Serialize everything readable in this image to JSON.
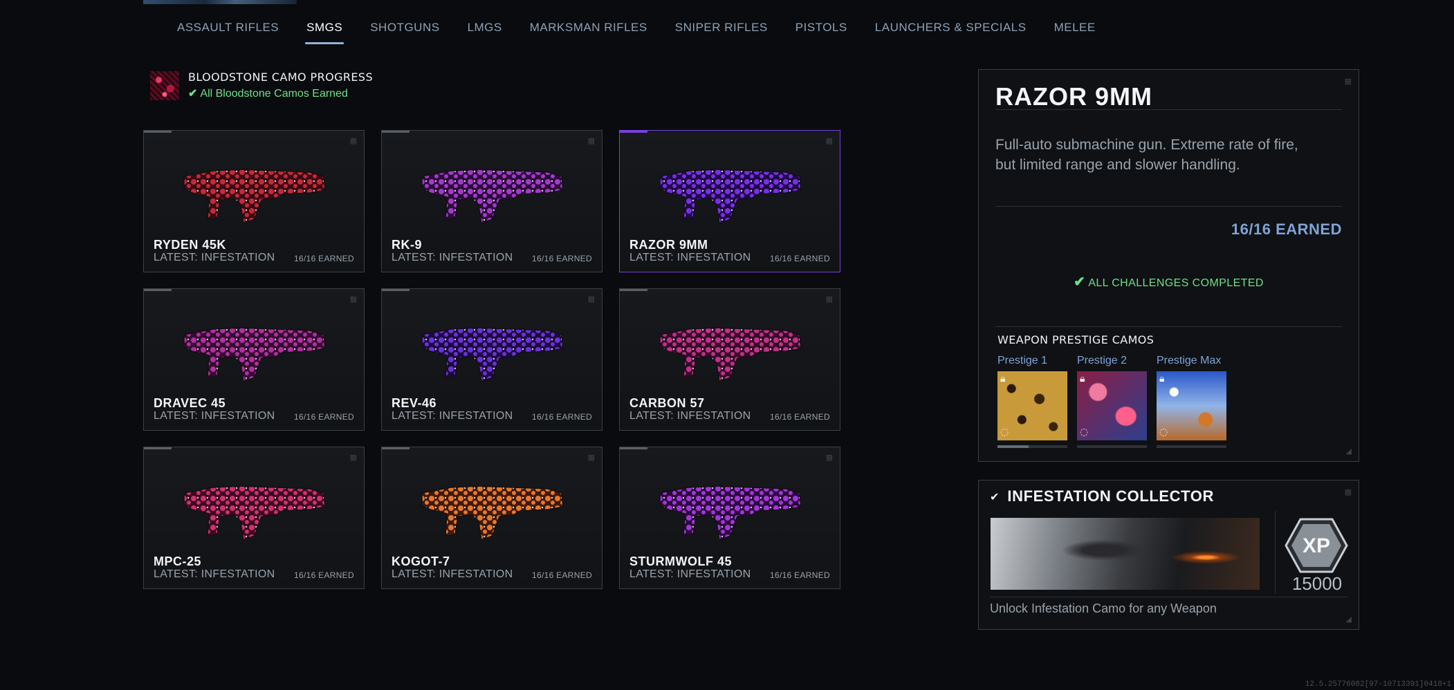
{
  "nav": {
    "tabs": [
      {
        "label": "ASSAULT RIFLES",
        "active": false
      },
      {
        "label": "SMGS",
        "active": true
      },
      {
        "label": "SHOTGUNS",
        "active": false
      },
      {
        "label": "LMGS",
        "active": false
      },
      {
        "label": "MARKSMAN RIFLES",
        "active": false
      },
      {
        "label": "SNIPER RIFLES",
        "active": false
      },
      {
        "label": "PISTOLS",
        "active": false
      },
      {
        "label": "LAUNCHERS & SPECIALS",
        "active": false
      },
      {
        "label": "MELEE",
        "active": false
      }
    ]
  },
  "camo_progress": {
    "title": "BLOODSTONE CAMO PROGRESS",
    "status": "All Bloodstone Camos Earned",
    "status_icon": "check-icon"
  },
  "weapons": [
    {
      "name": "RYDEN 45K",
      "latest": "LATEST: INFESTATION",
      "earned": "16/16 EARNED",
      "camo_colors": [
        "#c42a3a",
        "#3a0a12"
      ]
    },
    {
      "name": "RK-9",
      "latest": "LATEST: INFESTATION",
      "earned": "16/16 EARNED",
      "camo_colors": [
        "#a23acb",
        "#2c0b3a"
      ]
    },
    {
      "name": "RAZOR 9MM",
      "latest": "LATEST: INFESTATION",
      "earned": "16/16 EARNED",
      "camo_colors": [
        "#7a2ee8",
        "#1e0a44"
      ],
      "selected": true
    },
    {
      "name": "DRAVEC 45",
      "latest": "LATEST: INFESTATION",
      "earned": "16/16 EARNED",
      "camo_colors": [
        "#b0309e",
        "#330b30"
      ]
    },
    {
      "name": "REV-46",
      "latest": "LATEST: INFESTATION",
      "earned": "16/16 EARNED",
      "camo_colors": [
        "#6a32d8",
        "#1c0a3e"
      ]
    },
    {
      "name": "CARBON 57",
      "latest": "LATEST: INFESTATION",
      "earned": "16/16 EARNED",
      "camo_colors": [
        "#c0308a",
        "#350b26"
      ]
    },
    {
      "name": "MPC-25",
      "latest": "LATEST: INFESTATION",
      "earned": "16/16 EARNED",
      "camo_colors": [
        "#d23070",
        "#3a0a20"
      ]
    },
    {
      "name": "KOGOT-7",
      "latest": "LATEST: INFESTATION",
      "earned": "16/16 EARNED",
      "camo_colors": [
        "#e8782e",
        "#3e1a08"
      ]
    },
    {
      "name": "STURMWOLF 45",
      "latest": "LATEST: INFESTATION",
      "earned": "16/16 EARNED",
      "camo_colors": [
        "#a236d8",
        "#2a0a3c"
      ]
    }
  ],
  "detail": {
    "title": "RAZOR 9MM",
    "description": "Full-auto submachine gun. Extreme rate of fire, but limited range and slower handling.",
    "earned": "16/16 EARNED",
    "complete": "ALL CHALLENGES COMPLETED",
    "prestige_heading": "WEAPON PRESTIGE CAMOS",
    "prestige": [
      {
        "label": "Prestige 1",
        "locked": true,
        "progress": 0.45
      },
      {
        "label": "Prestige 2",
        "locked": true,
        "progress": 0
      },
      {
        "label": "Prestige Max",
        "locked": true,
        "progress": 0
      }
    ]
  },
  "reward": {
    "title": "INFESTATION COLLECTOR",
    "xp_label": "XP",
    "xp_value": "15000",
    "description": "Unlock Infestation Camo for any Weapon"
  },
  "version": "12.5.25776082[97-10713391]0418+1"
}
